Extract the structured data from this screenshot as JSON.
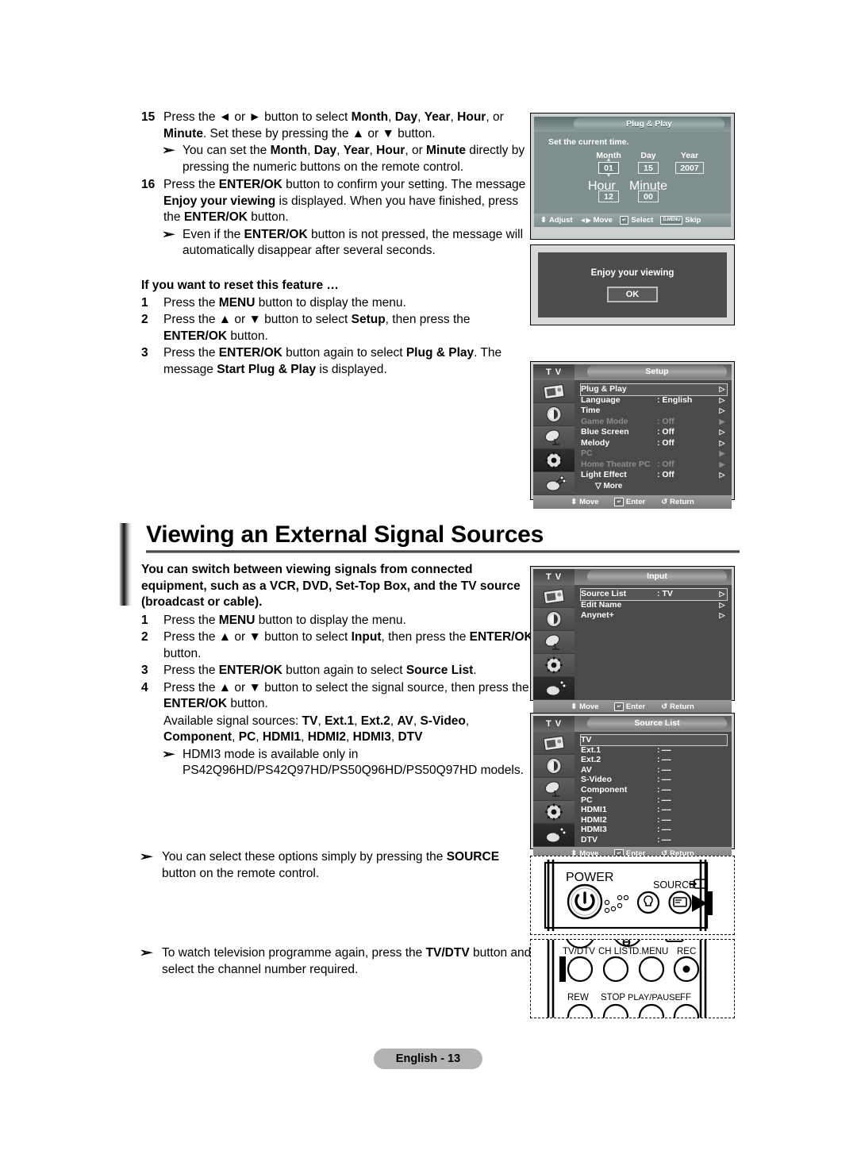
{
  "steps_top": [
    {
      "num": "15",
      "text_html": "Press the ◄ or ► button to select <b>Month</b>, <b>Day</b>, <b>Year</b>, <b>Hour</b>, or <b>Minute</b>. Set these by pressing the ▲ or ▼ button.",
      "note": "You can set the <b>Month</b>, <b>Day</b>, <b>Year</b>, <b>Hour</b>, or <b>Minute</b> directly by pressing the numeric buttons on the remote control."
    },
    {
      "num": "16",
      "text_html": "Press the <b>ENTER/OK</b> button to confirm your setting. The message <b>Enjoy your viewing</b> is displayed. When you have finished, press the <b>ENTER/OK</b> button.",
      "note": "Even if the <b>ENTER/OK</b> button is not pressed, the message will automatically disappear after several seconds."
    }
  ],
  "reset_section": {
    "heading": "If you want to reset this feature …",
    "steps": [
      {
        "num": "1",
        "text_html": "Press the <b>MENU</b> button to display the menu."
      },
      {
        "num": "2",
        "text_html": "Press the ▲ or ▼ button to select <b>Setup</b>, then press the <b>ENTER/OK</b> button."
      },
      {
        "num": "3",
        "text_html": "Press the <b>ENTER/OK</b> button again to select <b>Plug &amp; Play</b>. The message <b>Start Plug &amp; Play</b> is displayed."
      }
    ]
  },
  "section": {
    "title": "Viewing an External Signal Sources",
    "lede": "You can switch between viewing signals from connected equipment, such as a VCR, DVD, Set-Top Box, and the TV source (broadcast or cable).",
    "steps": [
      {
        "num": "1",
        "text_html": "Press the <b>MENU</b> button to display the menu."
      },
      {
        "num": "2",
        "text_html": "Press the ▲ or ▼ button to select <b>Input</b>, then press the <b>ENTER/OK</b> button."
      },
      {
        "num": "3",
        "text_html": "Press the <b>ENTER/OK</b> button again to select <b>Source List</b>."
      },
      {
        "num": "4",
        "text_html": "Press the ▲ or ▼ button to select the signal source, then press the <b>ENTER/OK</b> button."
      }
    ],
    "available_sources_html": "Available signal sources: <b>TV</b>, <b>Ext.1</b>, <b>Ext.2</b>, <b>AV</b>, <b>S-Video</b>, <b>Component</b>, <b>PC</b>, <b>HDMI1</b>, <b>HDMI2</b>, <b>HDMI3</b>, <b>DTV</b>",
    "hdmi3_note": "HDMI3 mode is available only in PS42Q96HD/PS42Q97HD/PS50Q96HD/PS50Q97HD models."
  },
  "bottom_notes": [
    "You can select these options simply by pressing the <b>SOURCE</b> button on the remote control.",
    "To watch television programme again, press the <b>TV/DTV</b> button and select the channel number required."
  ],
  "footer": {
    "label": "English - 13"
  },
  "osd": {
    "plug_play": {
      "title": "Plug & Play",
      "prompt": "Set the current time.",
      "headers_row1": [
        "Month",
        "Day",
        "Year"
      ],
      "values_row1": [
        "01",
        "15",
        "2007"
      ],
      "headers_row2": [
        "Hour",
        "Minute"
      ],
      "values_row2": [
        "12",
        "00"
      ],
      "footer": [
        {
          "key": "⬍",
          "label": "Adjust"
        },
        {
          "key": "◄►",
          "label": "Move"
        },
        {
          "key": "↵",
          "label": "Select"
        },
        {
          "key": "D.MENU",
          "label": "Skip"
        }
      ]
    },
    "enjoy": {
      "message": "Enjoy your viewing",
      "ok_label": "OK"
    },
    "setup": {
      "tv_label": "T V",
      "title": "Setup",
      "rows": [
        {
          "label": "Plug & Play",
          "value": "",
          "dim": false,
          "selected": true,
          "chev": "▷"
        },
        {
          "label": "Language",
          "value": ": English",
          "dim": false,
          "selected": false,
          "chev": "▷"
        },
        {
          "label": "Time",
          "value": "",
          "dim": false,
          "selected": false,
          "chev": "▷"
        },
        {
          "label": "Game Mode",
          "value": ": Off",
          "dim": true,
          "selected": false,
          "chev": "▶"
        },
        {
          "label": "Blue Screen",
          "value": ": Off",
          "dim": false,
          "selected": false,
          "chev": "▷"
        },
        {
          "label": "Melody",
          "value": ": Off",
          "dim": false,
          "selected": false,
          "chev": "▷"
        },
        {
          "label": "PC",
          "value": "",
          "dim": true,
          "selected": false,
          "chev": "▶"
        },
        {
          "label": "Home Theatre PC",
          "value": ": Off",
          "dim": true,
          "selected": false,
          "chev": "▶"
        },
        {
          "label": "Light Effect",
          "value": ": Off",
          "dim": false,
          "selected": false,
          "chev": "▷"
        }
      ],
      "more_label": "▽  More",
      "footer": [
        {
          "key": "⬍",
          "label": "Move"
        },
        {
          "key": "↵",
          "label": "Enter"
        },
        {
          "key": "↺",
          "label": "Return"
        }
      ]
    },
    "input": {
      "tv_label": "T V",
      "title": "Input",
      "rows": [
        {
          "label": "Source List",
          "value": ": TV",
          "dim": false,
          "selected": true,
          "chev": "▷"
        },
        {
          "label": "Edit Name",
          "value": "",
          "dim": false,
          "selected": false,
          "chev": "▷"
        },
        {
          "label": "Anynet+",
          "value": "",
          "dim": false,
          "selected": false,
          "chev": "▷"
        }
      ],
      "footer": [
        {
          "key": "⬍",
          "label": "Move"
        },
        {
          "key": "↵",
          "label": "Enter"
        },
        {
          "key": "↺",
          "label": "Return"
        }
      ]
    },
    "source_list": {
      "tv_label": "T V",
      "title": "Source List",
      "rows": [
        {
          "label": "TV",
          "value": "",
          "selected": true
        },
        {
          "label": "Ext.1",
          "value": ": ----",
          "selected": false
        },
        {
          "label": "Ext.2",
          "value": ": ----",
          "selected": false
        },
        {
          "label": "AV",
          "value": ": ----",
          "selected": false
        },
        {
          "label": "S-Video",
          "value": ": ----",
          "selected": false
        },
        {
          "label": "Component",
          "value": ": ----",
          "selected": false
        },
        {
          "label": "PC",
          "value": ": ----",
          "selected": false
        },
        {
          "label": "HDMI1",
          "value": ": ----",
          "selected": false
        },
        {
          "label": "HDMI2",
          "value": ": ----",
          "selected": false
        },
        {
          "label": "HDMI3",
          "value": ": ----",
          "selected": false
        },
        {
          "label": "DTV",
          "value": ": ----",
          "selected": false
        }
      ],
      "footer": [
        {
          "key": "⬍",
          "label": "Move"
        },
        {
          "key": "↵",
          "label": "Enter"
        },
        {
          "key": "↺",
          "label": "Return"
        }
      ]
    }
  },
  "remote": {
    "top": {
      "power_label": "POWER",
      "source_label": "SOURCE"
    },
    "bottom": {
      "row1": [
        "TV/DTV",
        "CH LIST",
        "D.MENU",
        "REC"
      ],
      "row2": [
        "REW",
        "STOP",
        "PLAY/PAUSE",
        "FF"
      ]
    }
  },
  "colors": {
    "osd_bg": "#4a4a4a",
    "osd_dim_text": "#8d8d8d",
    "plugplay_bg": "#7f8f8e",
    "footer_pill": "#b3b3b3"
  }
}
